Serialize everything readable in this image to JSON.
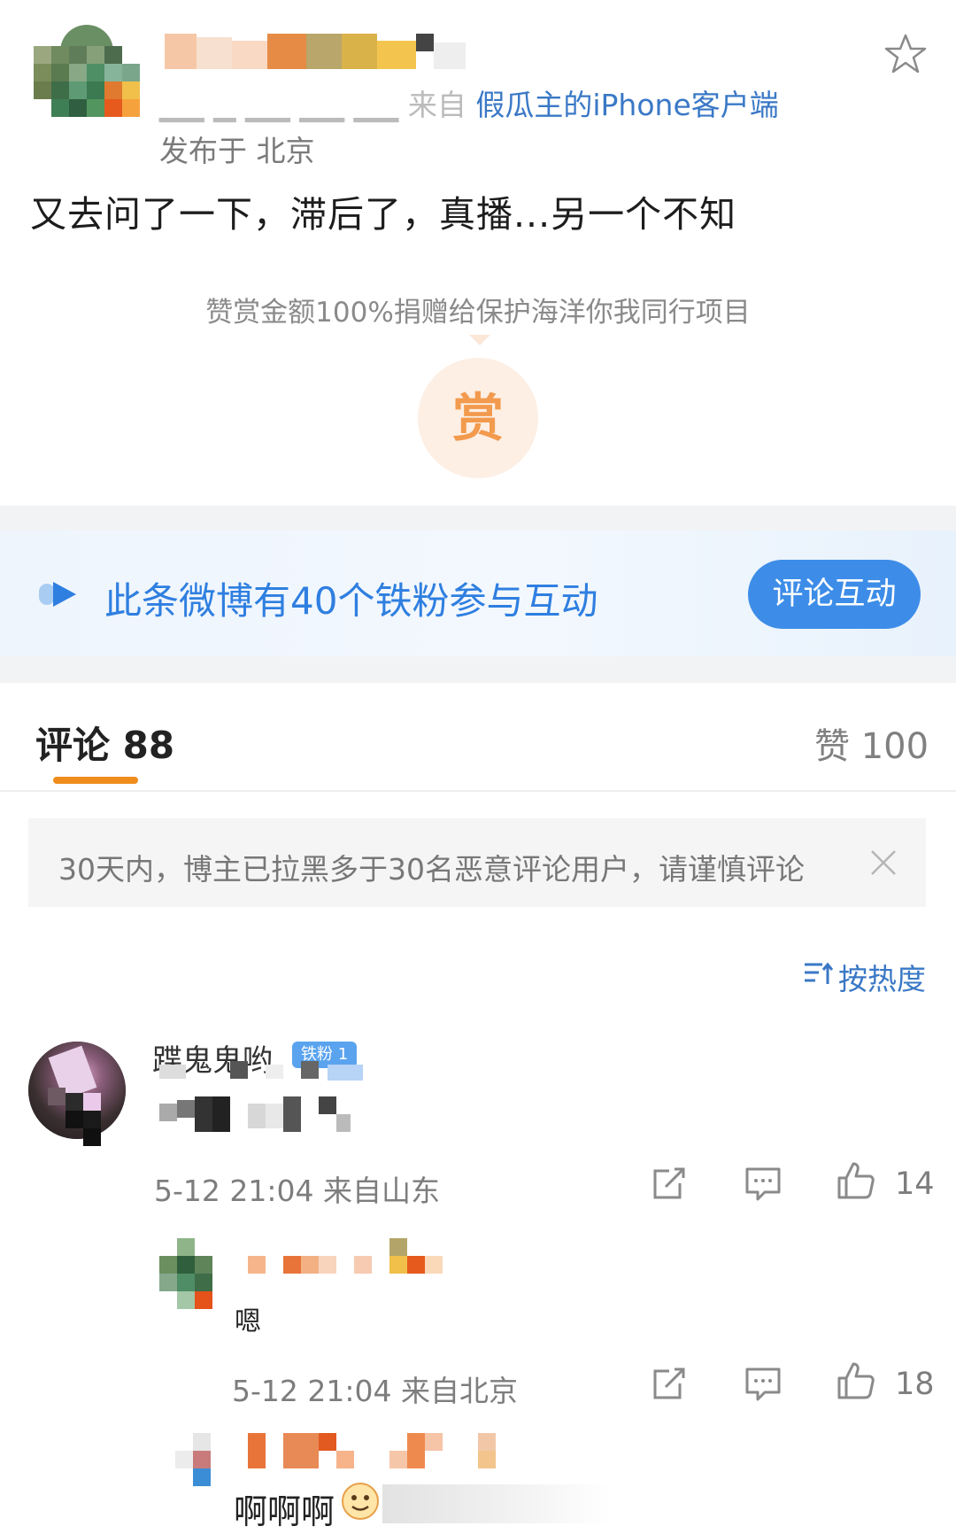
{
  "post": {
    "source_prefix": "来自",
    "source_client": "假瓜主的iPhone客户端",
    "location": "发布于 北京",
    "text": "又去问了一下，滞后了，真播...另一个不知",
    "reward_note": "赞赏金额100%捐赠给保护海洋你我同行项目",
    "reward_label": "赏"
  },
  "fan_banner": {
    "text": "此条微博有40个铁粉参与互动",
    "button": "评论互动"
  },
  "tabs": {
    "comments_label": "评论 88",
    "likes_label": "赞 100"
  },
  "notice": {
    "text": "30天内，博主已拉黑多于30名恶意评论用户，请谨慎评论"
  },
  "sort": {
    "label": "按热度"
  },
  "comments": [
    {
      "username": "蹀鬼鬼哟",
      "badge": "铁粉 1",
      "time": "5-12 21:04 来自山东",
      "likes": "14"
    }
  ],
  "replies": [
    {
      "text": "嗯",
      "time": "5-12 21:04 来自北京",
      "likes": "18"
    },
    {
      "text": "啊啊啊"
    }
  ],
  "colors": {
    "accent_blue": "#3d8de8",
    "link_blue": "#3a78c6",
    "tab_underline": "#f08c1c",
    "reward_orange": "#f29a4e"
  },
  "icons": [
    "star-icon",
    "fan-arrow-icon",
    "close-icon",
    "sort-icon",
    "share-icon",
    "comment-icon",
    "like-icon",
    "emoji-icon"
  ]
}
